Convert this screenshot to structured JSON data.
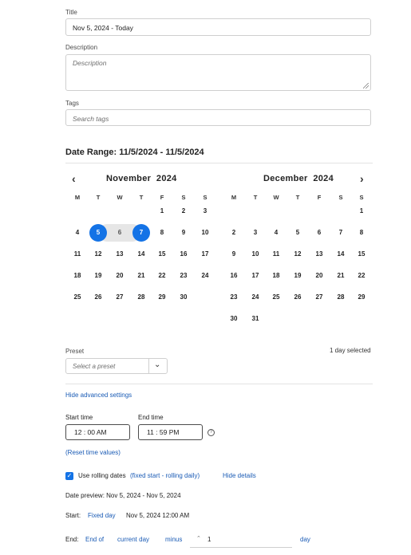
{
  "title": {
    "label": "Title",
    "value": "Nov 5, 2024 - Today"
  },
  "description": {
    "label": "Description",
    "placeholder": "Description"
  },
  "tags": {
    "label": "Tags",
    "placeholder": "Search tags"
  },
  "date_range": {
    "heading": "Date Range: 11/5/2024 - 11/5/2024"
  },
  "calendar": {
    "prev_icon": "chevron-left-icon",
    "next_icon": "chevron-right-icon",
    "left": {
      "month": "November",
      "year": "2024",
      "dow": [
        "M",
        "T",
        "W",
        "T",
        "F",
        "S",
        "S"
      ],
      "weeks": [
        [
          "",
          "",
          "",
          "",
          "1",
          "2",
          "3"
        ],
        [
          "4",
          "5",
          "6",
          "7",
          "8",
          "9",
          "10"
        ],
        [
          "11",
          "12",
          "13",
          "14",
          "15",
          "16",
          "17"
        ],
        [
          "18",
          "19",
          "20",
          "21",
          "22",
          "23",
          "24"
        ],
        [
          "25",
          "26",
          "27",
          "28",
          "29",
          "30",
          ""
        ]
      ]
    },
    "right": {
      "month": "December",
      "year": "2024",
      "dow": [
        "M",
        "T",
        "W",
        "T",
        "F",
        "S",
        "S"
      ],
      "weeks": [
        [
          "",
          "",
          "",
          "",
          "",
          "",
          "1"
        ],
        [
          "2",
          "3",
          "4",
          "5",
          "6",
          "7",
          "8"
        ],
        [
          "9",
          "10",
          "11",
          "12",
          "13",
          "14",
          "15"
        ],
        [
          "16",
          "17",
          "18",
          "19",
          "20",
          "21",
          "22"
        ],
        [
          "23",
          "24",
          "25",
          "26",
          "27",
          "28",
          "29"
        ],
        [
          "30",
          "31",
          "",
          "",
          "",
          "",
          ""
        ]
      ]
    },
    "selected_days": [
      "5",
      "7"
    ],
    "in_range_days": [
      "6"
    ],
    "selected_color": "#1473e6"
  },
  "preset": {
    "label": "Preset",
    "placeholder": "Select a preset",
    "selected_count": "1 day selected"
  },
  "advanced": {
    "hide_link": "Hide advanced settings",
    "start_time_label": "Start time",
    "start_time": "12 : 00  AM",
    "end_time_label": "End time",
    "end_time": "11 : 59  PM",
    "reset_link": "(Reset time values)"
  },
  "rolling": {
    "checked": true,
    "label": "Use rolling dates",
    "mode_link": "(fixed start - rolling daily)",
    "hide_details": "Hide details",
    "preview": "Date preview: Nov 5, 2024 - Nov 5, 2024",
    "start_label": "Start:",
    "start_mode": "Fixed day",
    "start_value": "Nov 5, 2024 12:00 AM",
    "end_label": "End:",
    "end_of": "End of",
    "end_current": "current day",
    "end_minus": "minus",
    "end_amount": "1",
    "end_unit": "day"
  }
}
